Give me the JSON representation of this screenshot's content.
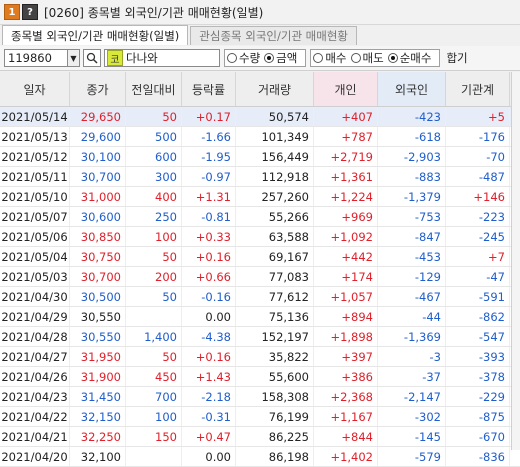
{
  "titlebar": {
    "badge_one": "1",
    "badge_q": "?",
    "title": "[0260] 종목별 외국인/기관 매매현황(일별)"
  },
  "tabs": [
    {
      "label": "종목별 외국인/기관 매매현황(일별)",
      "active": true
    },
    {
      "label": "관심종목 외국인/기관 매매현황",
      "active": false
    }
  ],
  "controls": {
    "code": "119860",
    "kosdaq_badge": "코",
    "stock_name": "다나와",
    "radio_unit": [
      {
        "label": "수량",
        "checked": false
      },
      {
        "label": "금액",
        "checked": true
      }
    ],
    "radio_type": [
      {
        "label": "매수",
        "checked": false
      },
      {
        "label": "매도",
        "checked": false
      },
      {
        "label": "순매수",
        "checked": true
      }
    ],
    "trail": "합기"
  },
  "table": {
    "headers": [
      "일자",
      "종가",
      "전일대비",
      "등락률",
      "거래량",
      "개인",
      "외국인",
      "기관계"
    ],
    "rows": [
      {
        "date": "2021/05/14",
        "close": "29,650",
        "chg": "50",
        "rate": "+0.17",
        "vol": "50,574",
        "ind": "+407",
        "frn": "-423",
        "inst": "+5",
        "dir": "up"
      },
      {
        "date": "2021/05/13",
        "close": "29,600",
        "chg": "500",
        "rate": "-1.66",
        "vol": "101,349",
        "ind": "+787",
        "frn": "-618",
        "inst": "-176",
        "dir": "down"
      },
      {
        "date": "2021/05/12",
        "close": "30,100",
        "chg": "600",
        "rate": "-1.95",
        "vol": "156,449",
        "ind": "+2,719",
        "frn": "-2,903",
        "inst": "-70",
        "dir": "down"
      },
      {
        "date": "2021/05/11",
        "close": "30,700",
        "chg": "300",
        "rate": "-0.97",
        "vol": "112,918",
        "ind": "+1,361",
        "frn": "-883",
        "inst": "-487",
        "dir": "down"
      },
      {
        "date": "2021/05/10",
        "close": "31,000",
        "chg": "400",
        "rate": "+1.31",
        "vol": "257,260",
        "ind": "+1,224",
        "frn": "-1,379",
        "inst": "+146",
        "dir": "up"
      },
      {
        "date": "2021/05/07",
        "close": "30,600",
        "chg": "250",
        "rate": "-0.81",
        "vol": "55,266",
        "ind": "+969",
        "frn": "-753",
        "inst": "-223",
        "dir": "down"
      },
      {
        "date": "2021/05/06",
        "close": "30,850",
        "chg": "100",
        "rate": "+0.33",
        "vol": "63,588",
        "ind": "+1,092",
        "frn": "-847",
        "inst": "-245",
        "dir": "up"
      },
      {
        "date": "2021/05/04",
        "close": "30,750",
        "chg": "50",
        "rate": "+0.16",
        "vol": "69,167",
        "ind": "+442",
        "frn": "-453",
        "inst": "+7",
        "dir": "up"
      },
      {
        "date": "2021/05/03",
        "close": "30,700",
        "chg": "200",
        "rate": "+0.66",
        "vol": "77,083",
        "ind": "+174",
        "frn": "-129",
        "inst": "-47",
        "dir": "up"
      },
      {
        "date": "2021/04/30",
        "close": "30,500",
        "chg": "50",
        "rate": "-0.16",
        "vol": "77,612",
        "ind": "+1,057",
        "frn": "-467",
        "inst": "-591",
        "dir": "down"
      },
      {
        "date": "2021/04/29",
        "close": "30,550",
        "chg": "",
        "rate": "0.00",
        "vol": "75,136",
        "ind": "+894",
        "frn": "-44",
        "inst": "-862",
        "dir": "flat"
      },
      {
        "date": "2021/04/28",
        "close": "30,550",
        "chg": "1,400",
        "rate": "-4.38",
        "vol": "152,197",
        "ind": "+1,898",
        "frn": "-1,369",
        "inst": "-547",
        "dir": "down"
      },
      {
        "date": "2021/04/27",
        "close": "31,950",
        "chg": "50",
        "rate": "+0.16",
        "vol": "35,822",
        "ind": "+397",
        "frn": "-3",
        "inst": "-393",
        "dir": "up"
      },
      {
        "date": "2021/04/26",
        "close": "31,900",
        "chg": "450",
        "rate": "+1.43",
        "vol": "55,600",
        "ind": "+386",
        "frn": "-37",
        "inst": "-378",
        "dir": "up"
      },
      {
        "date": "2021/04/23",
        "close": "31,450",
        "chg": "700",
        "rate": "-2.18",
        "vol": "158,308",
        "ind": "+2,368",
        "frn": "-2,147",
        "inst": "-229",
        "dir": "down"
      },
      {
        "date": "2021/04/22",
        "close": "32,150",
        "chg": "100",
        "rate": "-0.31",
        "vol": "76,199",
        "ind": "+1,167",
        "frn": "-302",
        "inst": "-875",
        "dir": "down"
      },
      {
        "date": "2021/04/21",
        "close": "32,250",
        "chg": "150",
        "rate": "+0.47",
        "vol": "86,225",
        "ind": "+844",
        "frn": "-145",
        "inst": "-670",
        "dir": "up"
      },
      {
        "date": "2021/04/20",
        "close": "32,100",
        "chg": "",
        "rate": "0.00",
        "vol": "86,198",
        "ind": "+1,402",
        "frn": "-579",
        "inst": "-836",
        "dir": "flat"
      }
    ]
  },
  "colors": {
    "up": "#e0202a",
    "down": "#1f5ecc",
    "flat": "#222222",
    "badge_one": "#e07a1f",
    "kosdaq_badge": "#d8e93a"
  }
}
